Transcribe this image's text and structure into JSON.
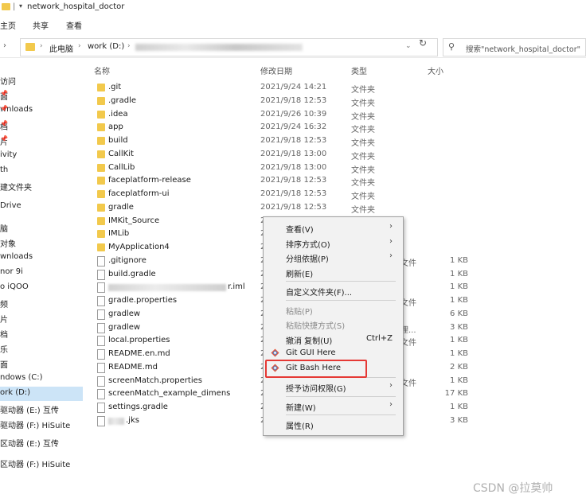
{
  "window": {
    "title": "network_hospital_doctor"
  },
  "ribbon": {
    "tabs": [
      "主页",
      "共享",
      "查看"
    ]
  },
  "address": {
    "crumbs": [
      "此电脑",
      "work (D:)"
    ],
    "search_placeholder": "搜索\"network_hospital_doctor\""
  },
  "nav_pane": {
    "items": [
      {
        "label": "访问",
        "pinned": false
      },
      {
        "label": "面",
        "pinned": true
      },
      {
        "label": "wnloads",
        "pinned": true
      },
      {
        "label": "档",
        "pinned": true
      },
      {
        "label": "片",
        "pinned": true
      },
      {
        "label": "ivity",
        "pinned": false
      },
      {
        "label": "th",
        "pinned": false
      },
      {
        "label": "建文件夹",
        "pinned": false
      },
      {
        "label": "Drive",
        "pinned": false
      },
      {
        "label": "脑",
        "pinned": false
      },
      {
        "label": "对象",
        "pinned": false
      },
      {
        "label": "wnloads",
        "pinned": false
      },
      {
        "label": "nor 9i",
        "pinned": false
      },
      {
        "label": "o iQOO",
        "pinned": false
      },
      {
        "label": "频",
        "pinned": false
      },
      {
        "label": "片",
        "pinned": false
      },
      {
        "label": "档",
        "pinned": false
      },
      {
        "label": "乐",
        "pinned": false
      },
      {
        "label": "面",
        "pinned": false
      },
      {
        "label": "ndows (C:)",
        "pinned": false
      },
      {
        "label": "ork (D:)",
        "pinned": false,
        "selected": true
      },
      {
        "label": "驱动器 (E:) 互传",
        "pinned": false
      },
      {
        "label": "驱动器 (F:) HiSuite",
        "pinned": false
      },
      {
        "label": "",
        "pinned": false
      },
      {
        "label": "区动器 (E:) 互传",
        "pinned": false
      },
      {
        "label": "",
        "pinned": false
      },
      {
        "label": "区动器 (F:) HiSuite",
        "pinned": false
      }
    ]
  },
  "columns": {
    "name": "名称",
    "date": "修改日期",
    "type": "类型",
    "size": "大小"
  },
  "files": [
    {
      "name": ".git",
      "date": "2021/9/24 14:21",
      "type": "文件夹",
      "size": "",
      "kind": "folder"
    },
    {
      "name": ".gradle",
      "date": "2021/9/18 12:53",
      "type": "文件夹",
      "size": "",
      "kind": "folder"
    },
    {
      "name": ".idea",
      "date": "2021/9/26 10:39",
      "type": "文件夹",
      "size": "",
      "kind": "folder"
    },
    {
      "name": "app",
      "date": "2021/9/24 16:32",
      "type": "文件夹",
      "size": "",
      "kind": "folder"
    },
    {
      "name": "build",
      "date": "2021/9/18 12:53",
      "type": "文件夹",
      "size": "",
      "kind": "folder"
    },
    {
      "name": "CallKit",
      "date": "2021/9/18 13:00",
      "type": "文件夹",
      "size": "",
      "kind": "folder"
    },
    {
      "name": "CallLib",
      "date": "2021/9/18 13:00",
      "type": "文件夹",
      "size": "",
      "kind": "folder"
    },
    {
      "name": "faceplatform-release",
      "date": "2021/9/18 12:53",
      "type": "文件夹",
      "size": "",
      "kind": "folder"
    },
    {
      "name": "faceplatform-ui",
      "date": "2021/9/18 12:53",
      "type": "文件夹",
      "size": "",
      "kind": "folder"
    },
    {
      "name": "gradle",
      "date": "2021/9/18 12:53",
      "type": "文件夹",
      "size": "",
      "kind": "folder"
    },
    {
      "name": "IMKit_Source",
      "date": "2",
      "type": "",
      "size": "",
      "kind": "folder"
    },
    {
      "name": "IMLib",
      "date": "2",
      "type": "",
      "size": "",
      "kind": "folder"
    },
    {
      "name": "MyApplication4",
      "date": "2",
      "type": "",
      "size": "",
      "kind": "folder"
    },
    {
      "name": ".gitignore",
      "date": "2",
      "type": "文件",
      "size": "1 KB",
      "kind": "file"
    },
    {
      "name": "build.gradle",
      "date": "2",
      "type": "",
      "size": "1 KB",
      "kind": "file"
    },
    {
      "name": "r.iml",
      "date": "2",
      "type": "",
      "size": "1 KB",
      "kind": "file",
      "blurred": true
    },
    {
      "name": "gradle.properties",
      "date": "2",
      "type": "文件",
      "size": "1 KB",
      "kind": "file"
    },
    {
      "name": "gradlew",
      "date": "2",
      "type": "",
      "size": "6 KB",
      "kind": "file"
    },
    {
      "name": "gradlew",
      "date": "2",
      "type": "理...",
      "size": "3 KB",
      "kind": "file"
    },
    {
      "name": "local.properties",
      "date": "2",
      "type": "文件",
      "size": "1 KB",
      "kind": "file"
    },
    {
      "name": "README.en.md",
      "date": "2",
      "type": "",
      "size": "1 KB",
      "kind": "file"
    },
    {
      "name": "README.md",
      "date": "2",
      "type": "",
      "size": "2 KB",
      "kind": "file"
    },
    {
      "name": "screenMatch.properties",
      "date": "2",
      "type": "文件",
      "size": "1 KB",
      "kind": "file"
    },
    {
      "name": "screenMatch_example_dimens",
      "date": "2",
      "type": "",
      "size": "17 KB",
      "kind": "file"
    },
    {
      "name": "settings.gradle",
      "date": "2",
      "type": "",
      "size": "1 KB",
      "kind": "file"
    },
    {
      "name": ".jks",
      "date": "2",
      "type": "",
      "size": "3 KB",
      "kind": "file",
      "blurred": true
    }
  ],
  "context_menu": {
    "items": [
      {
        "label": "查看(V)",
        "submenu": true
      },
      {
        "label": "排序方式(O)",
        "submenu": true
      },
      {
        "label": "分组依据(P)",
        "submenu": true
      },
      {
        "label": "刷新(E)"
      },
      {
        "sep": true
      },
      {
        "label": "自定义文件夹(F)..."
      },
      {
        "sep": true
      },
      {
        "label": "粘贴(P)",
        "disabled": true
      },
      {
        "label": "粘贴快捷方式(S)",
        "disabled": true
      },
      {
        "label": "撤消 复制(U)",
        "shortcut": "Ctrl+Z"
      },
      {
        "label": "Git GUI Here",
        "icon": "git-icon"
      },
      {
        "label": "Git Bash Here",
        "icon": "git-icon",
        "highlighted": true
      },
      {
        "sep": true
      },
      {
        "label": "授予访问权限(G)",
        "submenu": true
      },
      {
        "sep": true
      },
      {
        "label": "新建(W)",
        "submenu": true
      },
      {
        "sep": true
      },
      {
        "label": "属性(R)"
      }
    ]
  },
  "watermark": "CSDN @拉莫帅",
  "colors": {
    "folder": "#f2c94c",
    "highlight_box": "#e53935",
    "selection": "#cce4f7"
  }
}
